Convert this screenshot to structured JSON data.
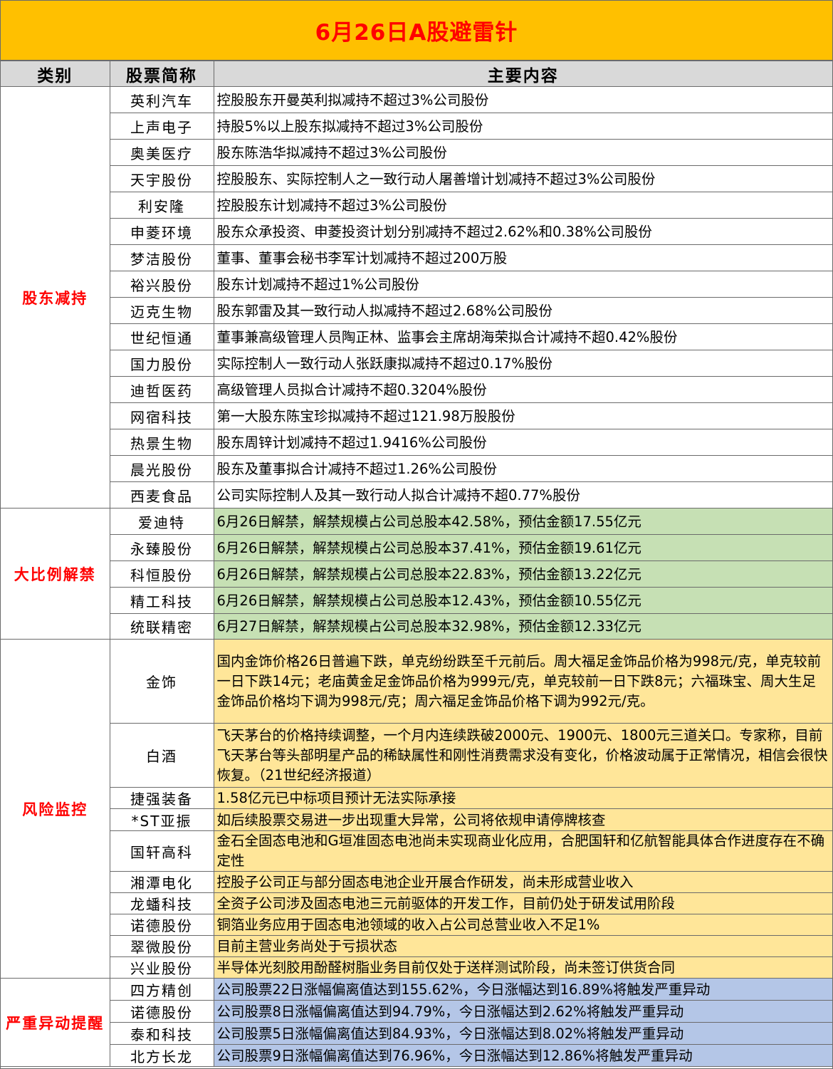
{
  "title": "6月26日A股避雷针",
  "headers": {
    "category": "类别",
    "name": "股票简称",
    "content": "主要内容"
  },
  "sections": {
    "reduce": {
      "label": "股东减持",
      "rows": [
        {
          "name": "英利汽车",
          "content": "控股股东开曼英利拟减持不超过3%公司股份"
        },
        {
          "name": "上声电子",
          "content": "持股5%以上股东拟减持不超过3%公司股份"
        },
        {
          "name": "奥美医疗",
          "content": "股东陈浩华拟减持不超过3%公司股份"
        },
        {
          "name": "天宇股份",
          "content": "控股股东、实际控制人之一致行动人屠善增计划减持不超过3%公司股份"
        },
        {
          "name": "利安隆",
          "content": "控股股东计划减持不超过3%公司股份"
        },
        {
          "name": "申菱环境",
          "content": "股东众承投资、申菱投资计划分别减持不超过2.62%和0.38%公司股份"
        },
        {
          "name": "梦洁股份",
          "content": "董事、董事会秘书李军计划减持不超过200万股"
        },
        {
          "name": "裕兴股份",
          "content": "股东计划减持不超过1%公司股份"
        },
        {
          "name": "迈克生物",
          "content": "股东郭雷及其一致行动人拟减持不超过2.68%公司股份"
        },
        {
          "name": "世纪恒通",
          "content": "董事兼高级管理人员陶正林、监事会主席胡海荣拟合计减持不超0.42%股份"
        },
        {
          "name": "国力股份",
          "content": "实际控制人一致行动人张跃康拟减持不超过0.17%股份"
        },
        {
          "name": "迪哲医药",
          "content": "高级管理人员拟合计减持不超0.3204%股份"
        },
        {
          "name": "网宿科技",
          "content": "第一大股东陈宝珍拟减持不超过121.98万股股份"
        },
        {
          "name": "热景生物",
          "content": "股东周锌计划减持不超过1.9416%公司股份"
        },
        {
          "name": "晨光股份",
          "content": "股东及董事拟合计减持不超过1.26%公司股份"
        },
        {
          "name": "西麦食品",
          "content": "公司实际控制人及其一致行动人拟合计减持不超0.77%股份"
        }
      ]
    },
    "unlock": {
      "label": "大比例解禁",
      "rows": [
        {
          "name": "爱迪特",
          "content": "6月26日解禁，解禁规模占公司总股本42.58%，预估金额17.55亿元"
        },
        {
          "name": "永臻股份",
          "content": "6月26日解禁，解禁规模占公司总股本37.41%，预估金额19.61亿元"
        },
        {
          "name": "科恒股份",
          "content": "6月26日解禁，解禁规模占公司总股本22.83%，预估金额13.22亿元"
        },
        {
          "name": "精工科技",
          "content": "6月26日解禁，解禁规模占公司总股本12.43%，预估金额10.55亿元"
        },
        {
          "name": "统联精密",
          "content": "6月27日解禁，解禁规模占公司总股本32.98%，预估金额12.33亿元"
        }
      ]
    },
    "risk": {
      "label": "风险监控",
      "rows": [
        {
          "name": "金饰",
          "content": "国内金饰价格26日普遍下跌，单克纷纷跌至千元前后。周大福足金饰品价格为998元/克，单克较前一日下跌14元；老庙黄金足金饰品价格为999元/克，单克较前一日下跌8元；六福珠宝、周大生足金饰品价格均下调为998元/克；周六福足金饰品价格下调为992元/克。"
        },
        {
          "name": "白酒",
          "content": "飞天茅台的价格持续调整，一个月内连续跌破2000元、1900元、1800元三道关口。专家称，目前飞天茅台等头部明星产品的稀缺属性和刚性消费需求没有变化，价格波动属于正常情况，相信会很快恢复。（21世纪经济报道）"
        },
        {
          "name": "捷强装备",
          "content": "1.58亿元已中标项目预计无法实际承接"
        },
        {
          "name": "*ST亚振",
          "content": "如后续股票交易进一步出现重大异常，公司将依规申请停牌核查"
        },
        {
          "name": "国轩高科",
          "content": "金石全固态电池和G垣准固态电池尚未实现商业化应用，合肥国轩和亿航智能具体合作进度存在不确定性"
        },
        {
          "name": "湘潭电化",
          "content": "控股子公司正与部分固态电池企业开展合作研发，尚未形成营业收入"
        },
        {
          "name": "龙蟠科技",
          "content": "全资子公司涉及固态电池三元前驱体的开发工作，目前仍处于研发试用阶段"
        },
        {
          "name": "诺德股份",
          "content": "铜箔业务应用于固态电池领域的收入占公司总营业收入不足1%"
        },
        {
          "name": "翠微股份",
          "content": "目前主营业务尚处于亏损状态"
        },
        {
          "name": "兴业股份",
          "content": "半导体光刻胶用酚醛树脂业务目前仅处于送样测试阶段，尚未签订供货合同"
        }
      ]
    },
    "abnormal": {
      "label": "严重异动提醒",
      "rows": [
        {
          "name": "四方精创",
          "content": "公司股票22日涨幅偏离值达到155.62%，今日涨幅达到16.89%将触发严重异动"
        },
        {
          "name": "诺德股份",
          "content": "公司股票8日涨幅偏离值达到94.79%，今日涨幅达到2.62%将触发严重异动"
        },
        {
          "name": "泰和科技",
          "content": "公司股票5日涨幅偏离值达到84.93%，今日涨幅达到8.02%将触发严重异动"
        },
        {
          "name": "北方长龙",
          "content": "公司股票9日涨幅偏离值达到76.96%，今日涨幅达到12.86%将触发严重异动"
        }
      ]
    }
  },
  "colors": {
    "title_bg": "#ffc000",
    "title_text": "#ff0000",
    "header_bg": "#d9d9d9",
    "category_text": "#ff0000",
    "unlock_bg": "#c6e0b4",
    "risk_bg": "#ffe699",
    "abnormal_bg": "#b4c6e7"
  }
}
